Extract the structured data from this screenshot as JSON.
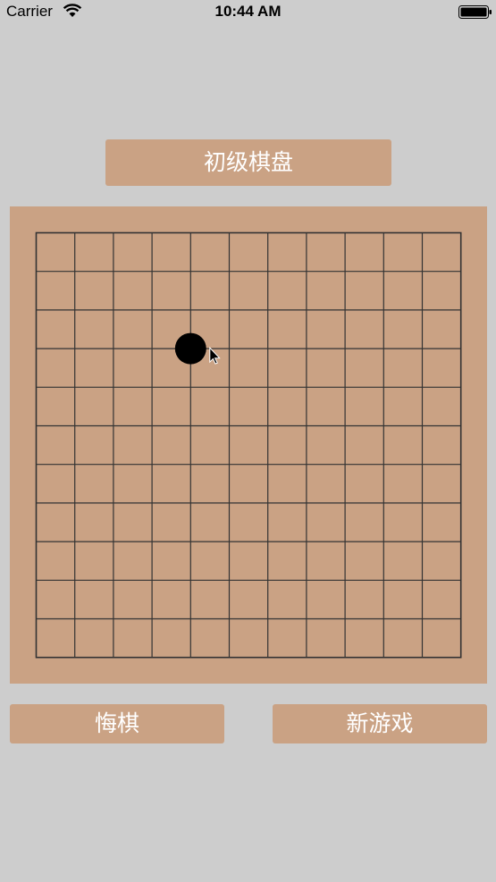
{
  "status_bar": {
    "carrier": "Carrier",
    "time": "10:44 AM"
  },
  "header": {
    "title_button_label": "初级棋盘"
  },
  "board": {
    "rows": 11,
    "cols": 11,
    "line_color": "#333333",
    "background_color": "#caa284",
    "stones": [
      {
        "color": "black",
        "row": 3,
        "col": 4
      }
    ],
    "cursor": {
      "row": 3,
      "col": 4
    }
  },
  "controls": {
    "undo_label": "悔棋",
    "new_game_label": "新游戏"
  },
  "colors": {
    "background": "#cdcdcd",
    "accent": "#caa284",
    "button_text": "#ffffff"
  }
}
